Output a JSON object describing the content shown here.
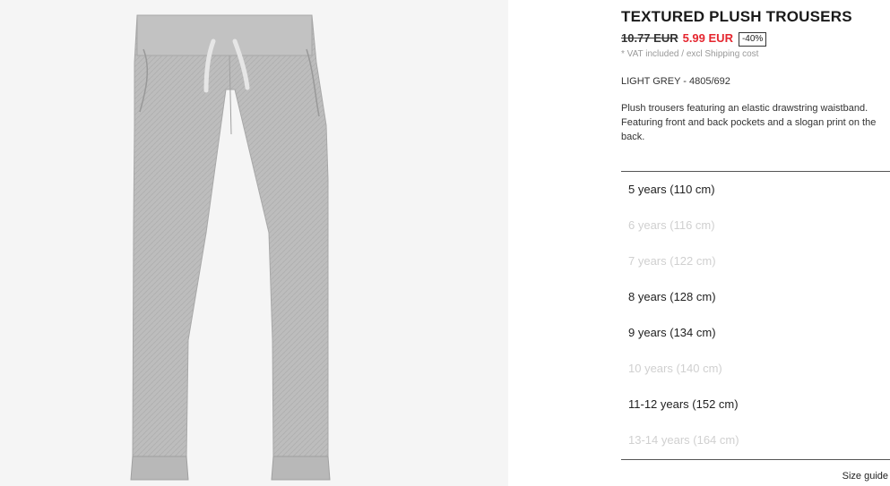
{
  "product": {
    "title": "TEXTURED PLUSH TROUSERS",
    "old_price": "10.77 EUR",
    "new_price": "5.99 EUR",
    "discount": "-40%",
    "vat_note": "* VAT included / excl Shipping cost",
    "color_ref": "LIGHT GREY - 4805/692",
    "description": "Plush trousers featuring an elastic drawstring waistband. Featuring front and back pockets and a slogan print on the back."
  },
  "sizes": [
    {
      "label": "5 years (110 cm)",
      "available": true
    },
    {
      "label": "6 years (116 cm)",
      "available": false
    },
    {
      "label": "7 years (122 cm)",
      "available": false
    },
    {
      "label": "8 years (128 cm)",
      "available": true
    },
    {
      "label": "9 years (134 cm)",
      "available": true
    },
    {
      "label": "10 years (140 cm)",
      "available": false
    },
    {
      "label": "11-12 years (152 cm)",
      "available": true
    },
    {
      "label": "13-14 years (164 cm)",
      "available": false
    }
  ],
  "size_guide_label": "Size guide",
  "colors": {
    "sale_price": "#e5262f",
    "fabric": "#bdbdbd",
    "image_background": "#f5f5f5"
  },
  "image": {
    "icon": "trousers-image"
  }
}
